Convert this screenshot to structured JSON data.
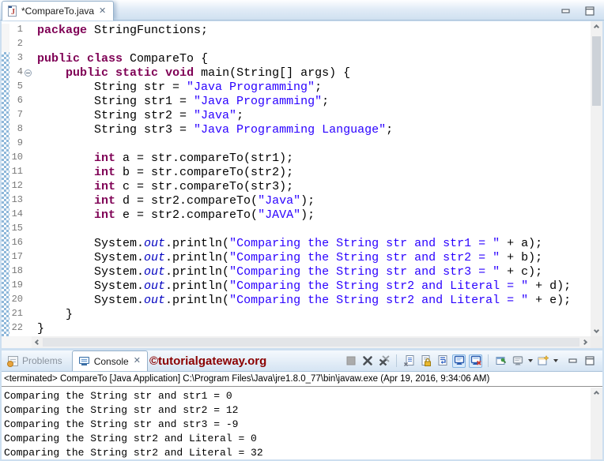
{
  "editor": {
    "tab": {
      "title": "*CompareTo.java",
      "icon": "java-file-icon"
    },
    "code_lines": [
      {
        "num": 1,
        "changed": false,
        "fold": false,
        "segs": [
          [
            "kw",
            "package"
          ],
          [
            "pl",
            " StringFunctions;"
          ]
        ]
      },
      {
        "num": 2,
        "changed": false,
        "fold": false,
        "segs": []
      },
      {
        "num": 3,
        "changed": true,
        "fold": false,
        "segs": [
          [
            "kw",
            "public"
          ],
          [
            "pl",
            " "
          ],
          [
            "kw",
            "class"
          ],
          [
            "pl",
            " CompareTo {"
          ]
        ]
      },
      {
        "num": 4,
        "changed": true,
        "fold": true,
        "segs": [
          [
            "pl",
            "    "
          ],
          [
            "kw",
            "public"
          ],
          [
            "pl",
            " "
          ],
          [
            "kw",
            "static"
          ],
          [
            "pl",
            " "
          ],
          [
            "kw",
            "void"
          ],
          [
            "pl",
            " main(String[] args) {"
          ]
        ]
      },
      {
        "num": 5,
        "changed": true,
        "fold": false,
        "segs": [
          [
            "pl",
            "        String str = "
          ],
          [
            "str",
            "\"Java Programming\""
          ],
          [
            "pl",
            ";"
          ]
        ]
      },
      {
        "num": 6,
        "changed": true,
        "fold": false,
        "segs": [
          [
            "pl",
            "        String str1 = "
          ],
          [
            "str",
            "\"Java Programming\""
          ],
          [
            "pl",
            ";"
          ]
        ]
      },
      {
        "num": 7,
        "changed": true,
        "fold": false,
        "segs": [
          [
            "pl",
            "        String str2 = "
          ],
          [
            "str",
            "\"Java\""
          ],
          [
            "pl",
            ";"
          ]
        ]
      },
      {
        "num": 8,
        "changed": true,
        "fold": false,
        "segs": [
          [
            "pl",
            "        String str3 = "
          ],
          [
            "str",
            "\"Java Programming Language\""
          ],
          [
            "pl",
            ";"
          ]
        ]
      },
      {
        "num": 9,
        "changed": true,
        "fold": false,
        "segs": []
      },
      {
        "num": 10,
        "changed": true,
        "fold": false,
        "segs": [
          [
            "pl",
            "        "
          ],
          [
            "kw",
            "int"
          ],
          [
            "pl",
            " a = str.compareTo(str1);"
          ]
        ]
      },
      {
        "num": 11,
        "changed": true,
        "fold": false,
        "segs": [
          [
            "pl",
            "        "
          ],
          [
            "kw",
            "int"
          ],
          [
            "pl",
            " b = str.compareTo(str2);"
          ]
        ]
      },
      {
        "num": 12,
        "changed": true,
        "fold": false,
        "segs": [
          [
            "pl",
            "        "
          ],
          [
            "kw",
            "int"
          ],
          [
            "pl",
            " c = str.compareTo(str3);"
          ]
        ]
      },
      {
        "num": 13,
        "changed": true,
        "fold": false,
        "segs": [
          [
            "pl",
            "        "
          ],
          [
            "kw",
            "int"
          ],
          [
            "pl",
            " d = str2.compareTo("
          ],
          [
            "str",
            "\"Java\""
          ],
          [
            "pl",
            ");"
          ]
        ]
      },
      {
        "num": 14,
        "changed": true,
        "fold": false,
        "segs": [
          [
            "pl",
            "        "
          ],
          [
            "kw",
            "int"
          ],
          [
            "pl",
            " e = str2.compareTo("
          ],
          [
            "str",
            "\"JAVA\""
          ],
          [
            "pl",
            ");"
          ]
        ]
      },
      {
        "num": 15,
        "changed": true,
        "fold": false,
        "segs": []
      },
      {
        "num": 16,
        "changed": true,
        "fold": false,
        "segs": [
          [
            "pl",
            "        System."
          ],
          [
            "sf",
            "out"
          ],
          [
            "pl",
            ".println("
          ],
          [
            "str",
            "\"Comparing the String str and str1 = \""
          ],
          [
            "pl",
            " + a);"
          ]
        ]
      },
      {
        "num": 17,
        "changed": true,
        "fold": false,
        "segs": [
          [
            "pl",
            "        System."
          ],
          [
            "sf",
            "out"
          ],
          [
            "pl",
            ".println("
          ],
          [
            "str",
            "\"Comparing the String str and str2 = \""
          ],
          [
            "pl",
            " + b);"
          ]
        ]
      },
      {
        "num": 18,
        "changed": true,
        "fold": false,
        "segs": [
          [
            "pl",
            "        System."
          ],
          [
            "sf",
            "out"
          ],
          [
            "pl",
            ".println("
          ],
          [
            "str",
            "\"Comparing the String str and str3 = \""
          ],
          [
            "pl",
            " + c);"
          ]
        ]
      },
      {
        "num": 19,
        "changed": true,
        "fold": false,
        "segs": [
          [
            "pl",
            "        System."
          ],
          [
            "sf",
            "out"
          ],
          [
            "pl",
            ".println("
          ],
          [
            "str",
            "\"Comparing the String str2 and Literal = \""
          ],
          [
            "pl",
            " + d);"
          ]
        ]
      },
      {
        "num": 20,
        "changed": true,
        "fold": false,
        "segs": [
          [
            "pl",
            "        System."
          ],
          [
            "sf",
            "out"
          ],
          [
            "pl",
            ".println("
          ],
          [
            "str",
            "\"Comparing the String str2 and Literal = \""
          ],
          [
            "pl",
            " + e);"
          ]
        ]
      },
      {
        "num": 21,
        "changed": true,
        "fold": false,
        "segs": [
          [
            "pl",
            "    }"
          ]
        ]
      },
      {
        "num": 22,
        "changed": true,
        "fold": false,
        "segs": [
          [
            "pl",
            "}"
          ]
        ]
      }
    ]
  },
  "console_panel": {
    "problems_tab_label": "Problems",
    "console_tab_label": "Console",
    "watermark": "©tutorialgateway.org",
    "status": "<terminated> CompareTo [Java Application] C:\\Program Files\\Java\\jre1.8.0_77\\bin\\javaw.exe (Apr 19, 2016, 9:34:06 AM)",
    "output": [
      "Comparing the String str and str1 = 0",
      "Comparing the String str and str2 = 12",
      "Comparing the String str and str3 = -9",
      "Comparing the String str2 and Literal = 0",
      "Comparing the String str2 and Literal = 32"
    ]
  },
  "icons": {
    "java-file-icon": "white page with red J",
    "close-icon": "✕",
    "problems-icon": "table with orange marker",
    "console-icon": "blue monitor",
    "terminate-icon": "gray square",
    "remove-launch-icon": "dark x",
    "remove-all-terminated-icon": "double x",
    "clear-console-icon": "page with x",
    "scroll-lock-icon": "page with gold lock",
    "word-wrap-icon": "page with blue return arrow",
    "show-stdout-icon": "blue monitor (toggled on)",
    "show-stderr-icon": "blue monitor with red x (toggled on)",
    "pin-console-icon": "window with green pin",
    "display-selected-console-icon": "gray monitor with dropdown",
    "open-console-icon": "window with sparkle and dropdown",
    "minimize-icon": "thin bar",
    "maximize-icon": "framed square",
    "chevron": "scroll arrows"
  },
  "colors": {
    "keyword": "#7F0055",
    "string": "#2A00FF",
    "static_field": "#0000C0",
    "line_number": "#787878",
    "watermark": "#8B0000",
    "tabbar_blue": "#D5E4F3"
  }
}
